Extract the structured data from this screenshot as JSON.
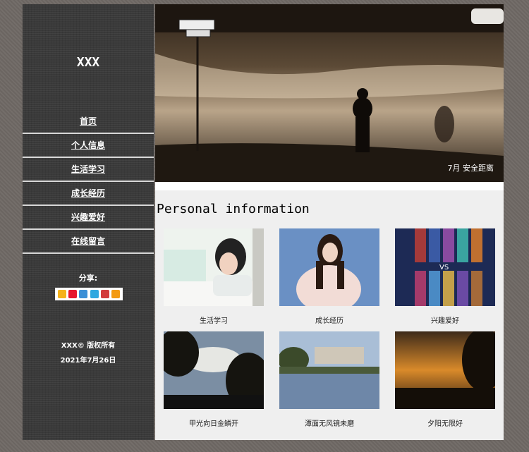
{
  "sidebar": {
    "site_title": "XXX",
    "nav": [
      "首页",
      "个人信息",
      "生活学习",
      "成长经历",
      "兴趣爱好",
      "在线留言"
    ],
    "share_label": "分享:",
    "share_icons": [
      "qzone-icon",
      "weibo-icon",
      "tencent-icon",
      "qq-icon",
      "renren-icon",
      "more-icon"
    ],
    "copyright": "XXX© 版权所有",
    "date": "2021年7月26日"
  },
  "main": {
    "banner_caption": "7月 安全距离",
    "section_title": "Personal information",
    "gallery": [
      {
        "caption": "生活学习",
        "icon": "girl-in-bed-photo"
      },
      {
        "caption": "成长经历",
        "icon": "girl-portrait-photo"
      },
      {
        "caption": "兴趣爱好",
        "icon": "game-heroes-photo"
      },
      {
        "caption": "甲光向日金鳞开",
        "icon": "tree-sunlight-photo"
      },
      {
        "caption": "潭面无风镜未磨",
        "icon": "lake-reflection-photo"
      },
      {
        "caption": "夕阳无限好",
        "icon": "sunset-photo"
      }
    ]
  }
}
